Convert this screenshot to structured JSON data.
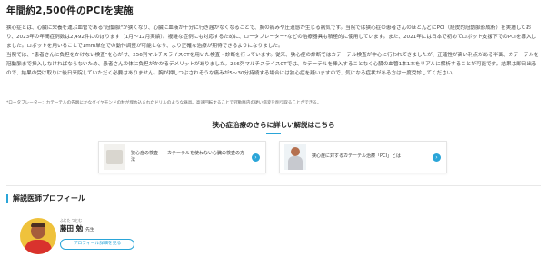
{
  "heading": "年間約2,500件のPCIを実施",
  "paragraphs": [
    "狭心症とは、心臓に栄養を運ぶ血管である\"冠動脈\"が狭くなり、心臓に血液が十分に行き届かなくなることで、胸の痛みや圧迫感が生じる病気です。当院では狭心症の患者さんのほとんどにPCI（経皮的冠動脈形成術）を実施しており、2023年の年間症例数は2,492件にのぼります（1月〜12月実績）。複雑な症例にも対応するために、ロータブレーター*などの治療器具も積極的に使用しています。また、2021年には日本で初めてロボット支援下でのPCIを導入しました。ロボットを用いることで1mm単位での動作調整が可能となり、より正確な治療が期待できるようになりました。",
    "当院では、\"患者さんに負担をかけない検査\"を心がけ、256列マルチスライスCTを用いた検査・診断を行っています。従来、狭心症の診断ではカテーテル検査が中心に行われてきましたが、正確性が高い利点がある半面、カテーテルを冠動脈まで挿入しなければならないため、患者さんの体に負担がかかるデメリットがありました。256列マルチスライスCTでは、カテーテルを挿入することなく心臓の血管1本1本をリアルに解析することが可能です。結果は即日出るので、結果の受け取りに後日来院していただく必要はありません。胸が押しつぶされそうな痛みが5〜30分持続する場合には狭心症を疑いますので、気になる症状がある方は一度受診してください。"
  ],
  "footnote": "*ロータブレーター：カテーテルの先端にかなダイヤモンドの粒が埋め込まれたドリルのような器具。高速回転することで冠動脈内の硬い病変を削り取ることができる。",
  "more_section": {
    "title": "狭心症治療のさらに詳しい解説はこちら",
    "cards": [
      {
        "label": "狭心症の検査――カテーテルを使わない心臓の検査の方法",
        "thumb_icon": "heart-model-image"
      },
      {
        "label": "狭心症に対するカテーテル治療「PCI」とは",
        "thumb_icon": "doctor-photo"
      }
    ],
    "arrow_icon": "chevron-right-icon"
  },
  "profile": {
    "section_title": "解説医師プロフィール",
    "ruby": "ふじた つとむ",
    "name": "藤田 勉",
    "suffix": "先生",
    "button_label": "プロフィール詳細を見る"
  },
  "colors": {
    "accent": "#2aa5d8",
    "avatar_bg": "#efc23c"
  }
}
